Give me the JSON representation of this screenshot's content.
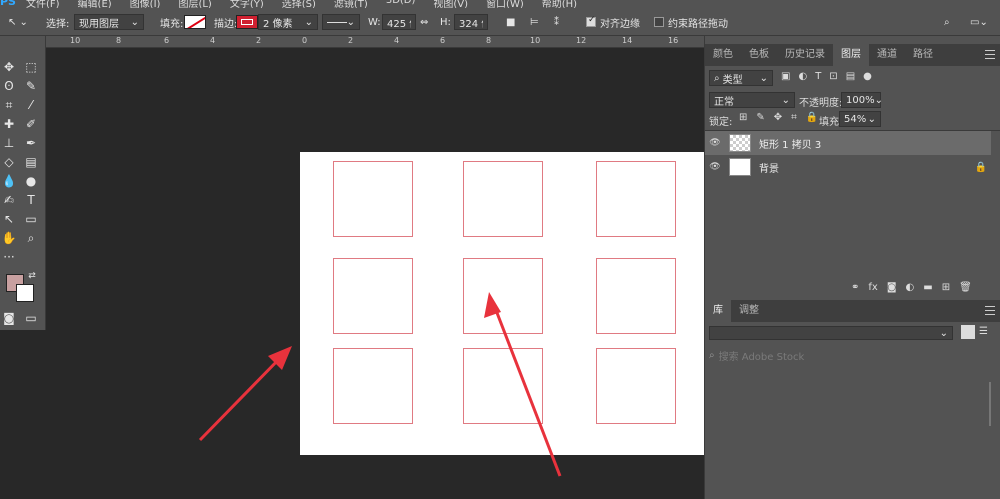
{
  "app": {
    "logo": "PS"
  },
  "menu": [
    "文件(F)",
    "编辑(E)",
    "图像(I)",
    "图层(L)",
    "文字(Y)",
    "选择(S)",
    "滤镜(T)",
    "3D(D)",
    "视图(V)",
    "窗口(W)",
    "帮助(H)"
  ],
  "options": {
    "select_label": "选择:",
    "select_value": "现用图层",
    "fill_label": "填充:",
    "stroke_label": "描边:",
    "stroke_width": "2 像素",
    "w_label": "W:",
    "w_value": "425 像素",
    "h_label": "H:",
    "h_value": "324 像素",
    "align_edges": "对齐边缘",
    "constrain_path": "约束路径拖动"
  },
  "ruler": {
    "ticks": [
      "10",
      "8",
      "6",
      "4",
      "2",
      "0",
      "2",
      "4",
      "6",
      "8",
      "10",
      "12",
      "14",
      "16"
    ]
  },
  "panels": {
    "top_tabs": [
      "颜色",
      "色板",
      "历史记录",
      "图层",
      "通道",
      "路径"
    ],
    "active_top_tab": "图层",
    "filter_kind": "类型",
    "blend_mode": "正常",
    "opacity_label": "不透明度:",
    "opacity_value": "100%",
    "lock_label": "锁定:",
    "fill_label": "填充:",
    "fill_value": "54%",
    "layers": [
      {
        "name": "矩形 1 拷贝 3",
        "selected": true
      },
      {
        "name": "背景",
        "locked": true
      }
    ],
    "bottom_tabs": [
      "库",
      "调整"
    ],
    "active_bottom_tab": "库",
    "search_placeholder": "搜索 Adobe Stock"
  },
  "colors": {
    "rect_stroke": "#e07a82",
    "arrow": "#e8323c",
    "foreground": "#c8a0a0",
    "background": "#ffffff"
  }
}
